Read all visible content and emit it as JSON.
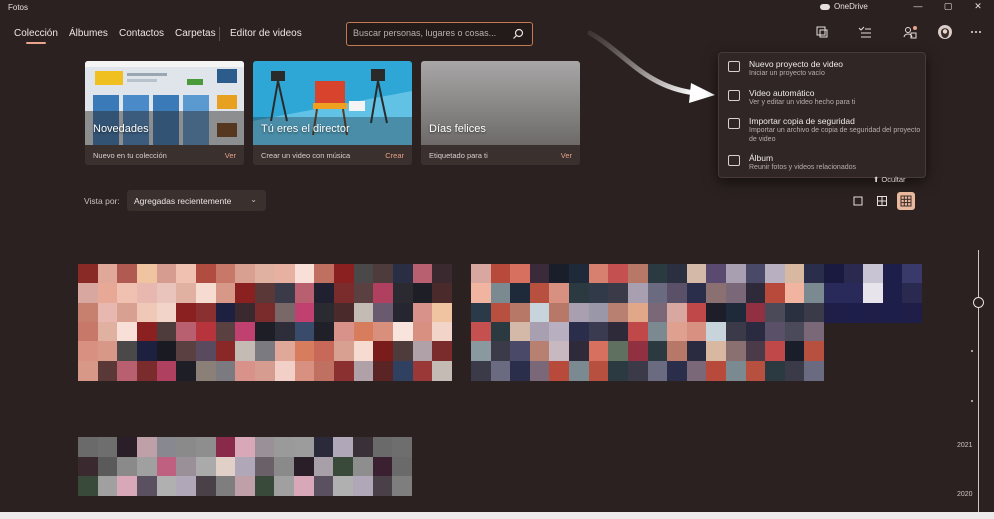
{
  "window": {
    "app_title": "Fotos",
    "onedrive_label": "OneDrive",
    "controls": [
      "—",
      "▢",
      "✕"
    ]
  },
  "nav": {
    "tabs": [
      {
        "label": "Colección",
        "active": true
      },
      {
        "label": "Álbumes"
      },
      {
        "label": "Contactos"
      },
      {
        "label": "Carpetas"
      },
      {
        "label": "Editor de videos"
      }
    ],
    "search_placeholder": "Buscar personas, lugares o cosas...",
    "header_icons": [
      "import-icon",
      "select-icon",
      "people-icon",
      "profile-avatar",
      "more-icon"
    ]
  },
  "cards": [
    {
      "title": "Novedades",
      "subtitle": "Nuevo en tu colección",
      "link": "Ver"
    },
    {
      "title": "Tú eres el director",
      "subtitle": "Crear un video con música",
      "link": "Crear"
    },
    {
      "title": "Días felices",
      "subtitle": "Etiquetado para ti",
      "link": "Ver"
    }
  ],
  "menu": {
    "items": [
      {
        "title": "Nuevo proyecto de video",
        "desc": "Iniciar un proyecto vacío",
        "icon": "video-project-icon"
      },
      {
        "title": "Video automático",
        "desc": "Ver y editar un video hecho para ti",
        "icon": "auto-video-icon"
      },
      {
        "title": "Importar copia de seguridad",
        "desc": "Importar un archivo de copia de seguridad del proyecto de video",
        "icon": "archive-icon"
      },
      {
        "title": "Álbum",
        "desc": "Reunir fotos y videos relacionados",
        "icon": "album-icon"
      }
    ]
  },
  "hide_label": "Ocultar",
  "view_by": {
    "label": "Vista por:",
    "selected": "Agregadas recientemente"
  },
  "view_modes": [
    "square-view-icon",
    "grid-view-icon",
    "dense-grid-view-icon"
  ],
  "timeline": {
    "years": [
      "2021",
      "2020"
    ]
  },
  "colors": {
    "background": "#2b2120",
    "accent": "#e8a38b",
    "search_border": "#c37a52",
    "menu_bg": "#2f2625"
  }
}
